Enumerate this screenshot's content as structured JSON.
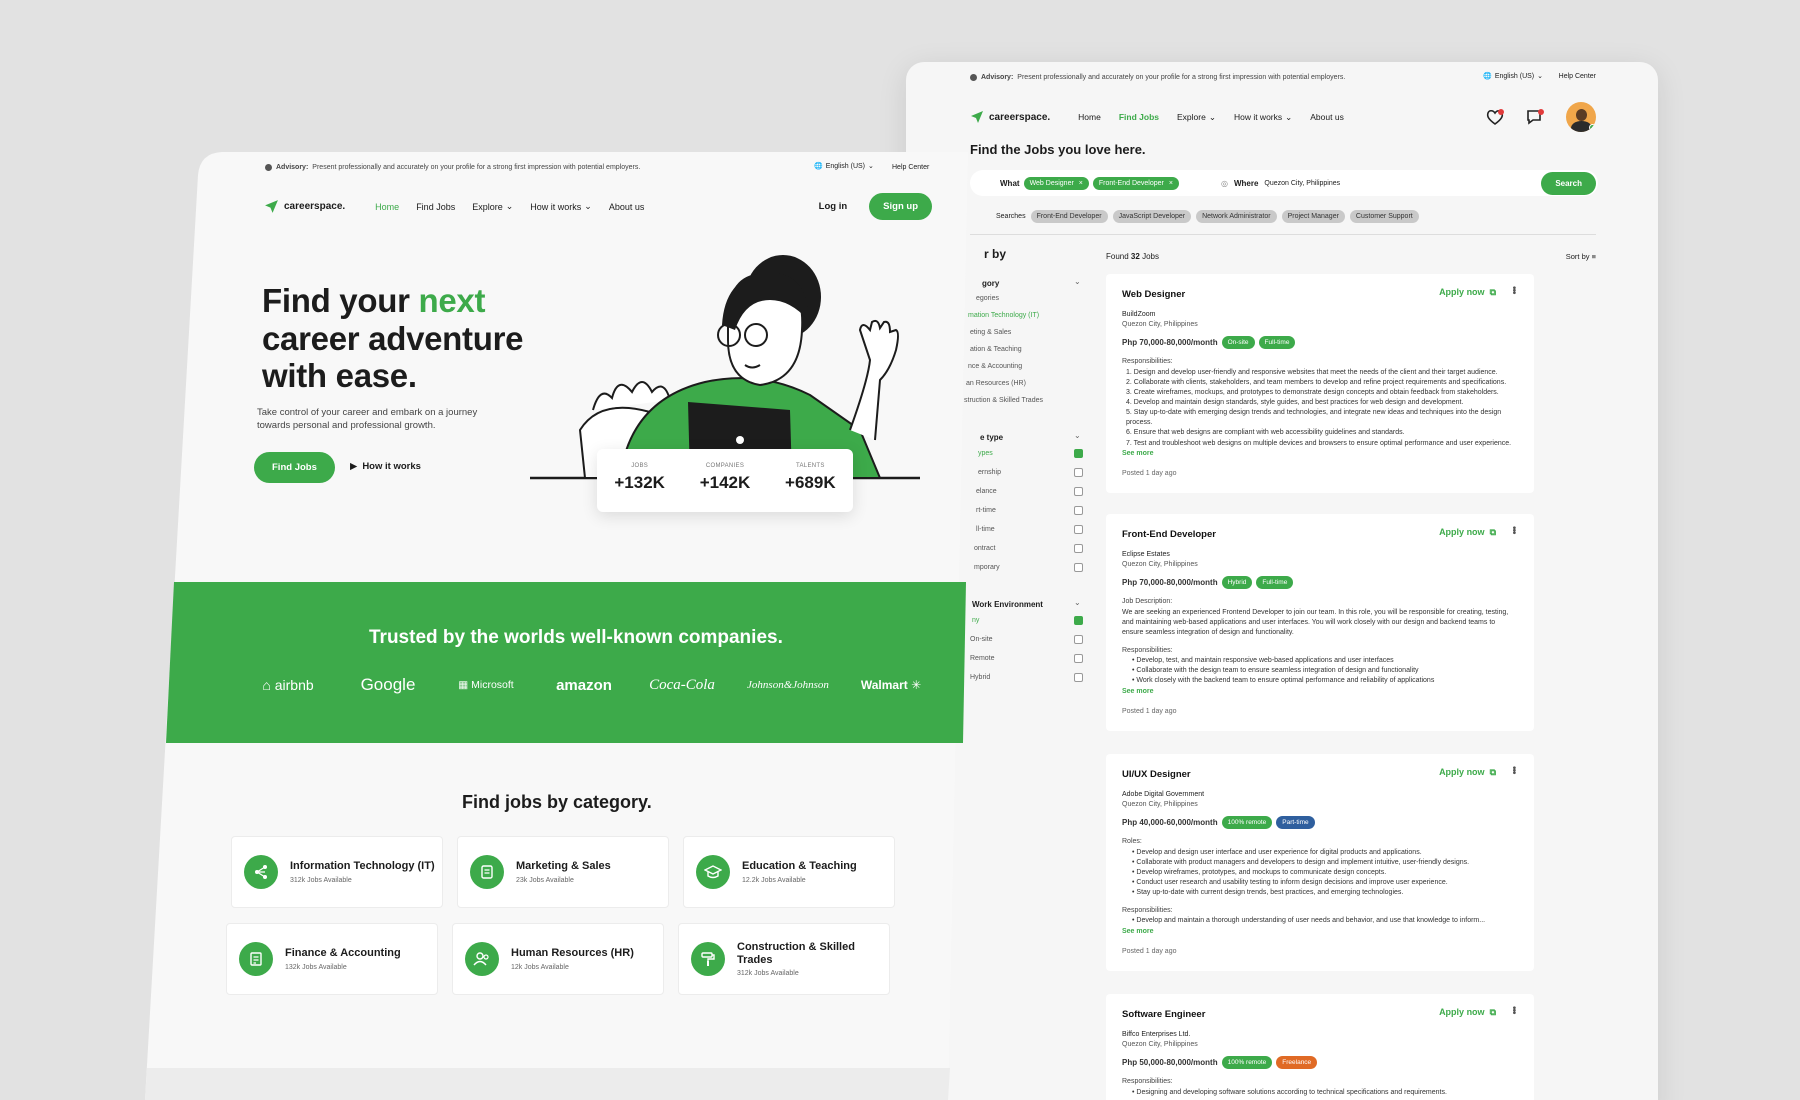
{
  "back": {
    "advisory_label": "Advisory:",
    "advisory_text": "Present professionally and accurately on your profile for a strong first impression with potential employers.",
    "language": "English (US)",
    "help": "Help Center",
    "brand": "careerspace.",
    "nav": [
      "Home",
      "Find Jobs",
      "Explore",
      "How it works",
      "About us"
    ],
    "title": "Find the Jobs you love here.",
    "search": {
      "what_label": "What",
      "chips": [
        "Web Designer",
        "Front-End Developer"
      ],
      "where_label": "Where",
      "where_value": "Quezon City, Philippines",
      "button": "Search"
    },
    "recent_label": "Searches",
    "recent": [
      "Front-End Developer",
      "JavaScript Developer",
      "Network Administrator",
      "Project Manager",
      "Customer Support"
    ],
    "filter": {
      "title": "r by",
      "category_label": "gory",
      "categories": [
        "egories",
        "mation Technology (IT)",
        "eting & Sales",
        "ation & Teaching",
        "nce & Accounting",
        "an Resources (HR)",
        "struction & Skilled Trades"
      ],
      "type_label": "e type",
      "types": [
        "ypes",
        "ernship",
        "elance",
        "rt-time",
        "ll-time",
        "ontract",
        "mporary"
      ],
      "env_label": "Work Environment",
      "envs": [
        "ny",
        "On-site",
        "Remote",
        "Hybrid"
      ]
    },
    "found_prefix": "Found",
    "found_count": "32",
    "found_suffix": "Jobs",
    "sort": "Sort by",
    "jobs": [
      {
        "title": "Web Designer",
        "company": "BuildZoom",
        "location": "Quezon City, Philippines",
        "salary": "Php 70,000-80,000/month",
        "tags": [
          {
            "label": "On-site",
            "color": "#3daa4a"
          },
          {
            "label": "Full-time",
            "color": "#3daa4a"
          }
        ],
        "section": "Responsibilities:",
        "lines": [
          "1. Design and develop user-friendly and responsive websites that meet the needs of the client and their target audience.",
          "2. Collaborate with clients, stakeholders, and team members to develop and refine project requirements and specifications.",
          "3. Create wireframes, mockups, and prototypes to demonstrate design concepts and obtain feedback from stakeholders.",
          "4. Develop and maintain design standards, style guides, and best practices for web design and development.",
          "5. Stay up-to-date with emerging design trends and technologies, and integrate new ideas and techniques into the design process.",
          "6. Ensure that web designs are compliant with web accessibility guidelines and standards.",
          "7. Test and troubleshoot web designs on multiple devices and browsers to ensure optimal performance and user experience."
        ],
        "more": "See more",
        "posted": "Posted 1 day ago",
        "apply": "Apply now"
      },
      {
        "title": "Front-End Developer",
        "company": "Eclipse Estates",
        "location": "Quezon City, Philippines",
        "salary": "Php 70,000-80,000/month",
        "tags": [
          {
            "label": "Hybrid",
            "color": "#3daa4a"
          },
          {
            "label": "Full-time",
            "color": "#3daa4a"
          }
        ],
        "section": "Job Description:",
        "desc": "We are seeking an experienced Frontend Developer to join our team. In this role, you will be responsible for creating, testing, and maintaining web-based applications and user interfaces. You will work closely with our design and backend teams to ensure seamless integration of design and functionality.",
        "section2": "Responsibilities:",
        "lines": [
          "Develop, test, and maintain responsive web-based applications and user interfaces",
          "Collaborate with the design team to ensure seamless integration of design and functionality",
          "Work closely with the backend team to ensure optimal performance and reliability of applications"
        ],
        "more": "See more",
        "posted": "Posted 1 day ago",
        "apply": "Apply now"
      },
      {
        "title": "UI/UX Designer",
        "company": "Adobe Digital Government",
        "location": "Quezon City, Philippines",
        "salary": "Php 40,000-60,000/month",
        "tags": [
          {
            "label": "100% remote",
            "color": "#3daa4a"
          },
          {
            "label": "Part-time",
            "color": "#2f5f9e"
          }
        ],
        "section": "Roles:",
        "lines": [
          "Develop and design user interface and user experience for digital products and applications.",
          "Collaborate with product managers and developers to design and implement intuitive, user-friendly designs.",
          "Develop wireframes, prototypes, and mockups to communicate design concepts.",
          "Conduct user research and usability testing to inform design decisions and improve user experience.",
          "Stay up-to-date with current design trends, best practices, and emerging technologies."
        ],
        "section2": "Responsibilities:",
        "lines2": [
          "Develop and maintain a thorough understanding of user needs and behavior, and use that knowledge to inform..."
        ],
        "more": "See more",
        "posted": "Posted 1 day ago",
        "apply": "Apply now"
      },
      {
        "title": "Software Engineer",
        "company": "Biffco Enterprises Ltd.",
        "location": "Quezon City, Philippines",
        "salary": "Php 50,000-80,000/month",
        "tags": [
          {
            "label": "100% remote",
            "color": "#3daa4a"
          },
          {
            "label": "Freelance",
            "color": "#e06a25"
          }
        ],
        "section": "Responsibilities:",
        "lines": [
          "Designing and developing software solutions according to technical specifications and requirements."
        ],
        "apply": "Apply now"
      }
    ]
  },
  "front": {
    "advisory_label": "Advisory:",
    "advisory_text": "Present professionally and accurately on your profile for a strong first impression with potential employers.",
    "language": "English (US)",
    "help": "Help Center",
    "brand": "careerspace.",
    "nav": [
      "Home",
      "Find Jobs",
      "Explore",
      "How it works",
      "About us"
    ],
    "login": "Log in",
    "signup": "Sign up",
    "hero_line1a": "Find your ",
    "hero_line1b": "next",
    "hero_line2": "career adventure",
    "hero_line3": "with ease.",
    "hero_sub": "Take control of your career and embark on a journey towards personal and professional growth.",
    "cta_find": "Find Jobs",
    "cta_how": "How it works",
    "stats": [
      {
        "label": "JOBS",
        "value": "+132K"
      },
      {
        "label": "COMPANIES",
        "value": "+142K"
      },
      {
        "label": "TALENTS",
        "value": "+689K"
      }
    ],
    "trusted": "Trusted by the worlds well-known companies.",
    "logos": [
      "airbnb",
      "Google",
      "Microsoft",
      "amazon",
      "Coca-Cola",
      "Johnson&Johnson",
      "Walmart"
    ],
    "cat_title": "Find jobs by category.",
    "categories": [
      {
        "name": "Information Technology (IT)",
        "count": "312k Jobs Available",
        "icon": "network-icon"
      },
      {
        "name": "Marketing & Sales",
        "count": "23k Jobs Available",
        "icon": "clipboard-icon"
      },
      {
        "name": "Education & Teaching",
        "count": "12.2k Jobs Available",
        "icon": "graduation-cap-icon"
      },
      {
        "name": "Finance & Accounting",
        "count": "132k Jobs Available",
        "icon": "ledger-icon"
      },
      {
        "name": "Human Resources (HR)",
        "count": "12k Jobs Available",
        "icon": "people-icon"
      },
      {
        "name": "Construction & Skilled Trades",
        "count": "312k Jobs Available",
        "icon": "paint-roller-icon"
      }
    ]
  },
  "colors": {
    "accent": "#3daa4a",
    "blue_tag": "#2f5f9e",
    "orange_tag": "#e06a25"
  }
}
